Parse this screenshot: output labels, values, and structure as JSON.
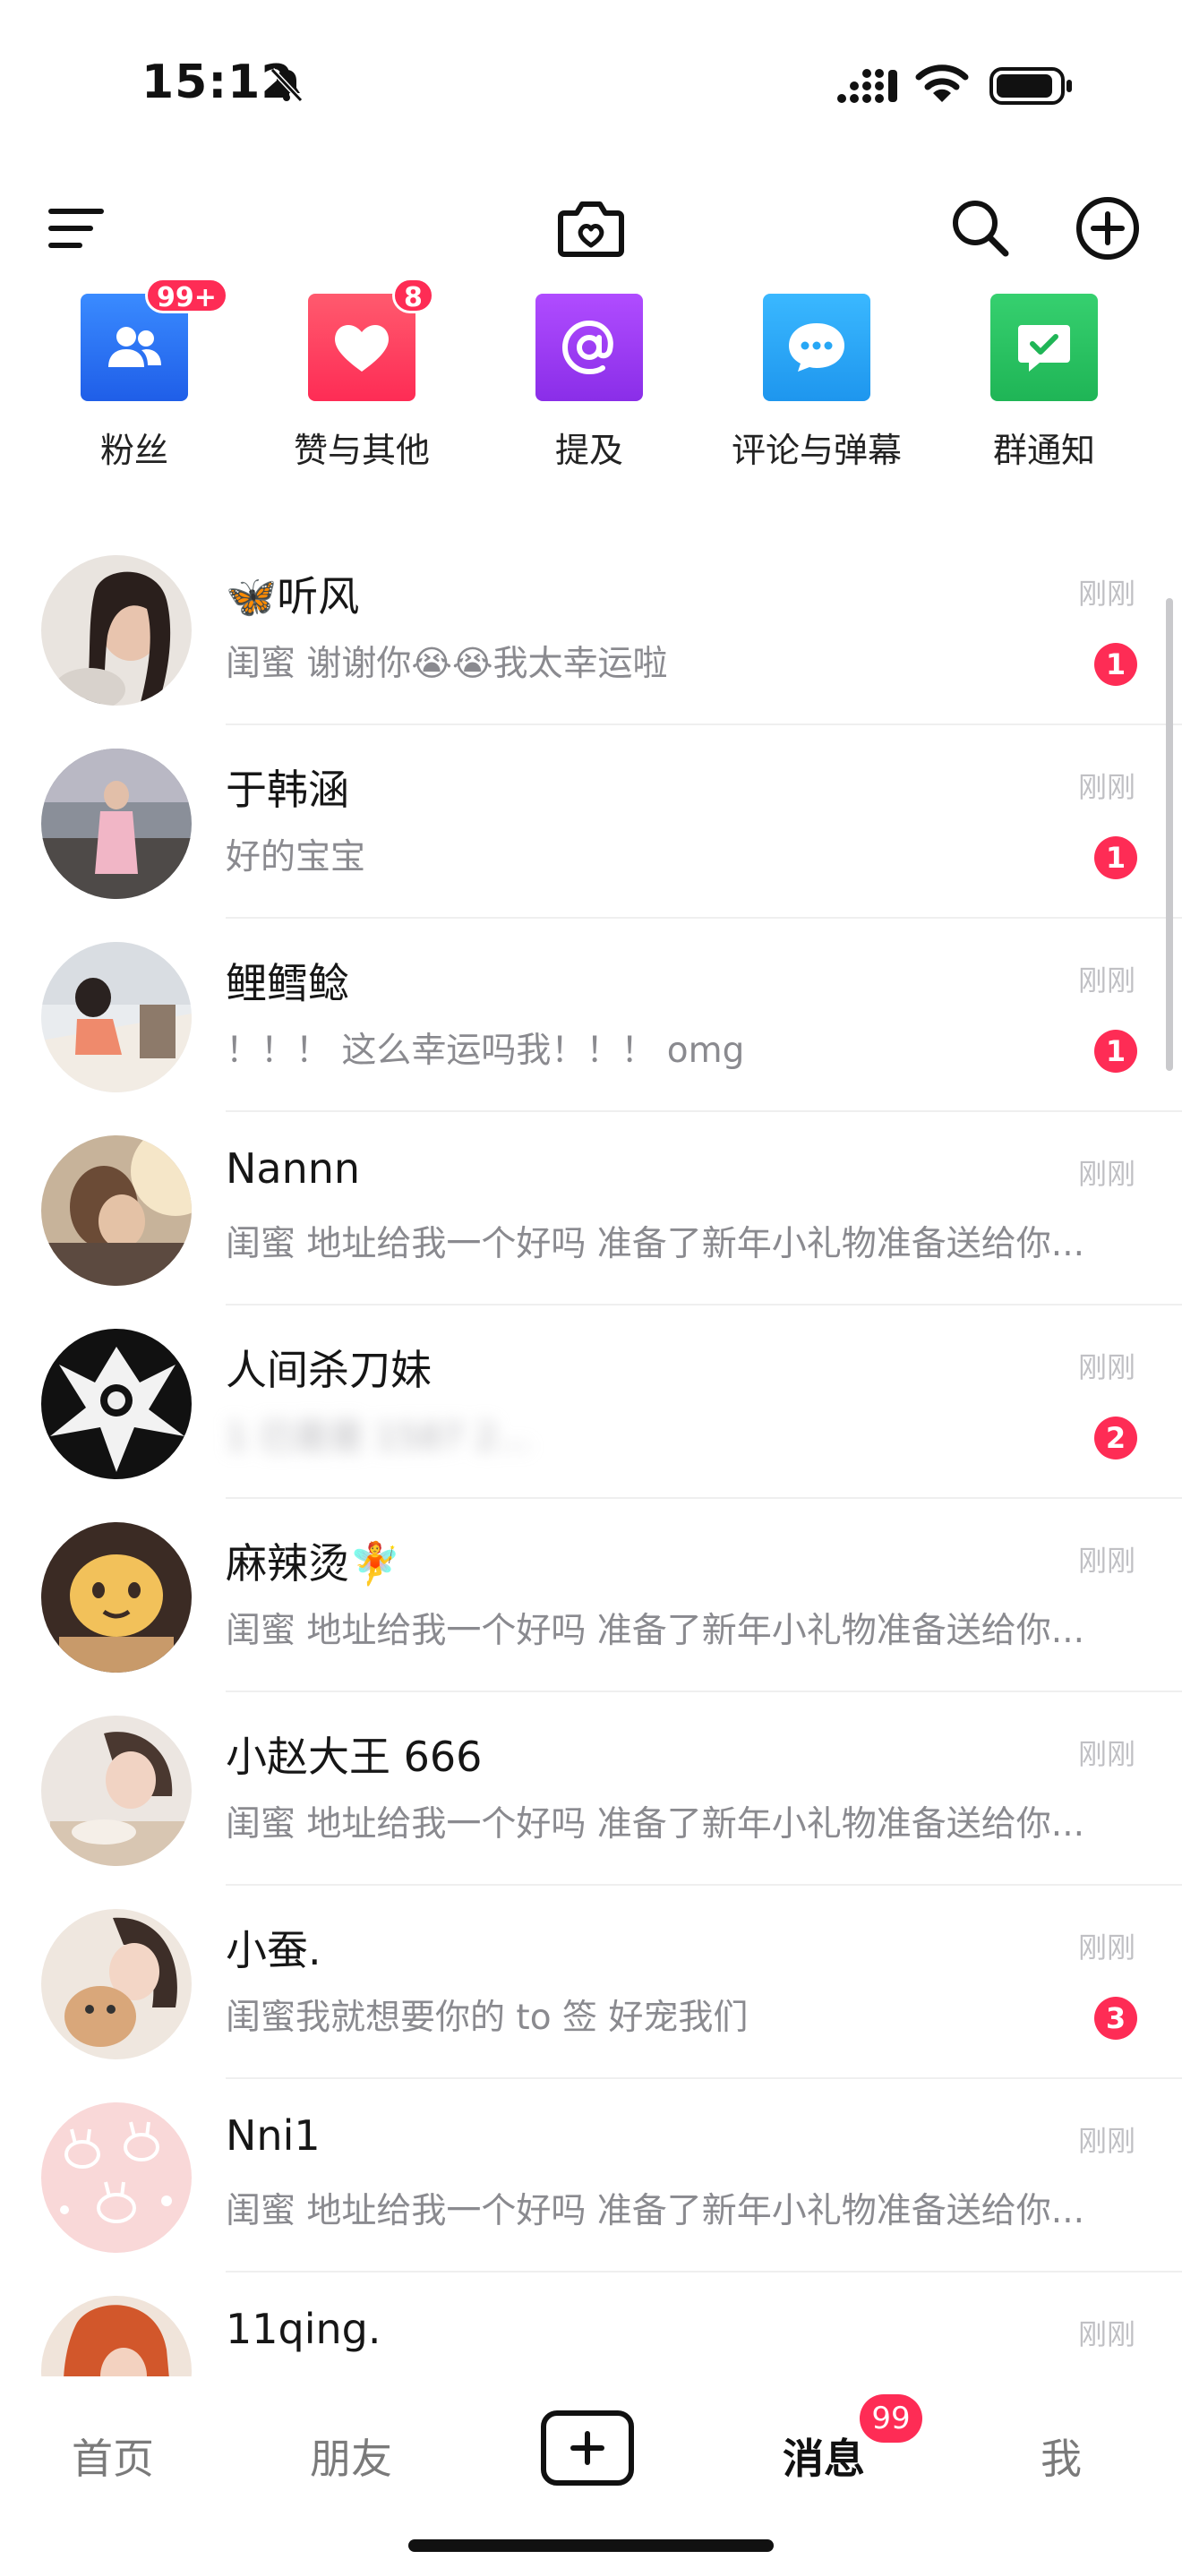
{
  "status_bar": {
    "time": "15:12",
    "battery_icon": "battery-icon",
    "wifi_icon": "wifi-icon",
    "signal_icon": "signal-icon",
    "bell_icon": "bell-slash-icon"
  },
  "top_bar": {
    "icons": [
      "menu-icon",
      "camera-heart-icon",
      "search-icon",
      "add-circle-icon"
    ]
  },
  "shortcuts": [
    {
      "label": "粉丝",
      "badge": "99+",
      "icon": "people-icon",
      "color": "#2f7bf5"
    },
    {
      "label": "赞与其他",
      "badge": "8",
      "icon": "heart-icon",
      "color": "#fe3a5c"
    },
    {
      "label": "提及",
      "badge": "",
      "icon": "at-icon",
      "color": "#9b3ff2"
    },
    {
      "label": "评论与弹幕",
      "badge": "",
      "icon": "comment-icon",
      "color": "#27a7f5"
    },
    {
      "label": "群通知",
      "badge": "",
      "icon": "group-check-icon",
      "color": "#27c160"
    }
  ],
  "conversations": [
    {
      "name": "🦋听风",
      "preview": "闺蜜 谢谢你😭😭我太幸运啦",
      "time": "刚刚",
      "unread": "1"
    },
    {
      "name": "于韩涵",
      "preview": "好的宝宝",
      "time": "刚刚",
      "unread": "1"
    },
    {
      "name": "鲤鳕鲶",
      "preview": "！！！ 这么幸运吗我！！！ omg",
      "time": "刚刚",
      "unread": "1"
    },
    {
      "name": "Nannn",
      "preview": "闺蜜 地址给我一个好吗 准备了新年小礼物准备送给你...",
      "time": "刚刚",
      "unread": ""
    },
    {
      "name": "人间杀刀妹",
      "preview": "1 已是是 1587 2...",
      "time": "刚刚",
      "unread": "2"
    },
    {
      "name": "麻辣烫🧚",
      "preview": "闺蜜 地址给我一个好吗 准备了新年小礼物准备送给你...",
      "time": "刚刚",
      "unread": ""
    },
    {
      "name": "小赵大王 666",
      "preview": "闺蜜 地址给我一个好吗 准备了新年小礼物准备送给你...",
      "time": "刚刚",
      "unread": ""
    },
    {
      "name": "小蚕.",
      "preview": "闺蜜我就想要你的 to 签 好宠我们",
      "time": "刚刚",
      "unread": "3"
    },
    {
      "name": "Nni1",
      "preview": "闺蜜 地址给我一个好吗 准备了新年小礼物准备送给你...",
      "time": "刚刚",
      "unread": ""
    },
    {
      "name": "11qing.",
      "preview": "",
      "time": "刚刚",
      "unread": ""
    }
  ],
  "bottom_nav": {
    "home": "首页",
    "friends": "朋友",
    "messages": "消息",
    "messages_badge": "99",
    "me": "我"
  }
}
